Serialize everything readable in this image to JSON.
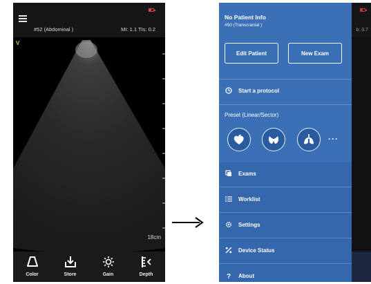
{
  "left_screen": {
    "exam": "#52 (Abdominal )",
    "mi_tis": "MI: 1.1 TIs: 0.2",
    "probe_marker": "V",
    "depth": "18cm",
    "toolbar": [
      {
        "label": "Color",
        "icon": "color-mode-icon"
      },
      {
        "label": "Store",
        "icon": "store-download-icon"
      },
      {
        "label": "Gain",
        "icon": "gain-brightness-icon"
      },
      {
        "label": "Depth",
        "icon": "depth-icon"
      }
    ]
  },
  "right_screen": {
    "background_fragment": "b: 0.7",
    "drawer": {
      "patient_title": "No Patient Info",
      "patient_subtitle": "#50 (Transcranial )",
      "edit_patient": "Edit Patient",
      "new_exam": "New Exam",
      "start_protocol": "Start a protocol",
      "preset_title": "Preset (Linear/Sector)",
      "presets": [
        {
          "icon": "cardiac-heart-icon"
        },
        {
          "icon": "thyroid-icon"
        },
        {
          "icon": "lung-icon"
        }
      ],
      "more": "···",
      "menu": [
        {
          "label": "Exams",
          "icon": "exams-icon"
        },
        {
          "label": "Worklist",
          "icon": "worklist-icon"
        },
        {
          "label": "Settings",
          "icon": "settings-gear-icon"
        },
        {
          "label": "Device Status",
          "icon": "device-status-icon"
        },
        {
          "label": "About",
          "icon": "about-question-icon"
        }
      ]
    }
  },
  "colors": {
    "drawer_blue": "#3b70b7",
    "toolbar_dark": "#1a1a1a",
    "battery_red": "#e23b3b",
    "marker_yellow": "#d9c23a"
  }
}
